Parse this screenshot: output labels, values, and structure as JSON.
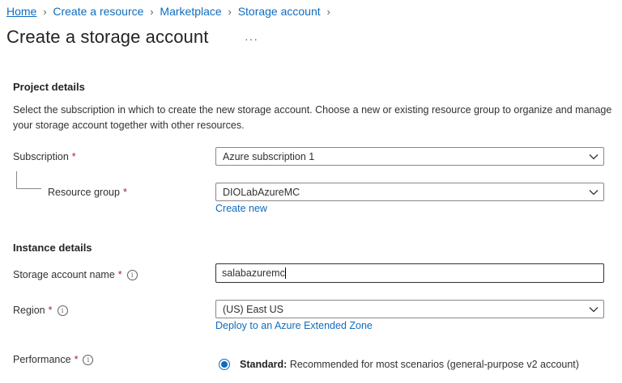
{
  "breadcrumb": {
    "items": [
      "Home",
      "Create a resource",
      "Marketplace",
      "Storage account"
    ]
  },
  "page": {
    "title": "Create a storage account",
    "more": "···"
  },
  "project_details": {
    "heading": "Project details",
    "description": "Select the subscription in which to create the new storage account. Choose a new or existing resource group to organize and manage your storage account together with other resources.",
    "subscription": {
      "label": "Subscription",
      "required": "*",
      "value": "Azure subscription 1"
    },
    "resource_group": {
      "label": "Resource group",
      "required": "*",
      "value": "DIOLabAzureMC",
      "create_new": "Create new"
    }
  },
  "instance_details": {
    "heading": "Instance details",
    "storage_name": {
      "label": "Storage account name",
      "required": "*",
      "value": "salabazuremc"
    },
    "region": {
      "label": "Region",
      "required": "*",
      "value": "(US) East US",
      "link": "Deploy to an Azure Extended Zone"
    },
    "performance": {
      "label": "Performance",
      "required": "*",
      "option_bold": "Standard:",
      "option_text": " Recommended for most scenarios (general-purpose v2 account)"
    }
  },
  "colors": {
    "link": "#0f6cbd",
    "required": "#a4262c",
    "border": "#8a8886",
    "text": "#323130"
  },
  "icons": [
    "chevron-right-icon",
    "chevron-down-icon",
    "info-icon",
    "radio-selected-icon"
  ]
}
